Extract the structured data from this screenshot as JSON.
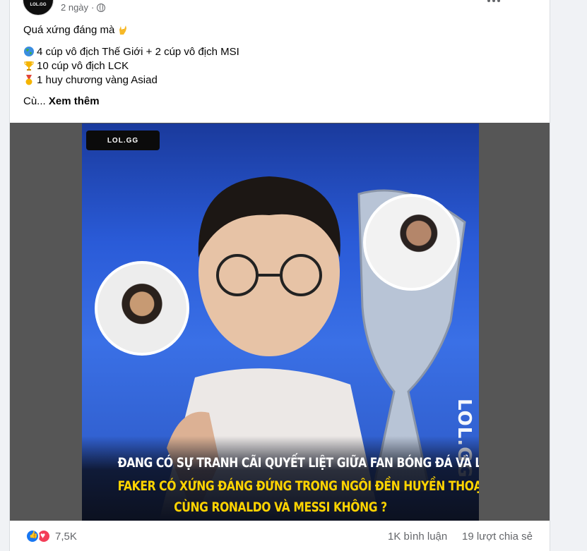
{
  "post": {
    "author_logo": "LOL.GG",
    "time": "2 ngày",
    "privacy_icon": "globe-icon",
    "lines": [
      "Quá xứng đáng mà",
      "4 cúp vô địch Thế Giới + 2 cúp vô địch MSI",
      "10 cúp vô địch LCK",
      "1 huy chương vàng Asiad"
    ],
    "truncated_prefix": "Cù...",
    "see_more": "Xem thêm"
  },
  "media": {
    "badge": "LOL.GG",
    "side_logo": "LOL.GG",
    "caption_1": "ĐANG CÓ SỰ TRANH CÃI QUYẾT LIỆT GIỮA FAN BÓNG ĐÁ VÀ LOL",
    "caption_2": "FAKER CÓ XỨNG ĐÁNG ĐỨNG TRONG NGÔI ĐỀN HUYỀN THOẠI",
    "caption_3": "CÙNG RONALDO VÀ MESSI KHÔNG ?"
  },
  "footer": {
    "reaction_count": "7,5K",
    "comments": "1K bình luận",
    "shares": "19 lượt chia sẻ"
  },
  "colors": {
    "accent": "#1877f2",
    "love": "#f33e58",
    "caption_yellow": "#ffd400"
  }
}
